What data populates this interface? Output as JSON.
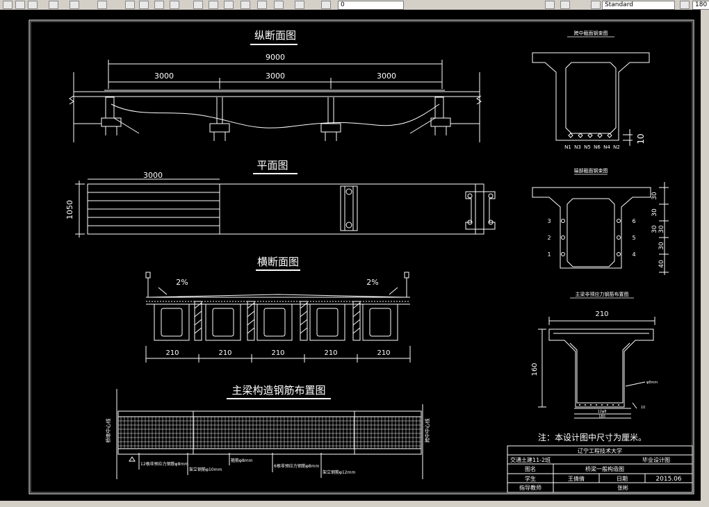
{
  "toolbar": {
    "text_style_value": "Standard",
    "number_field_value": "180",
    "small_field_value": "0"
  },
  "drawing": {
    "longitudinal": {
      "title": "纵断面图",
      "total_span": "9000",
      "spans": [
        "3000",
        "3000",
        "3000"
      ]
    },
    "plan": {
      "title": "平面图",
      "length_label": "3000",
      "width_label": "1050"
    },
    "cross_section": {
      "title": "横断面图",
      "slope_left": "2%",
      "slope_right": "2%",
      "beam_widths": [
        "210",
        "210",
        "210",
        "210",
        "210"
      ]
    },
    "main_beam_rebar": {
      "title": "主梁构造钢筋布置图",
      "left_axis_label": "桥墩中心线",
      "right_axis_label": "跨中中心线",
      "callouts": [
        "12根非预应力钢筋φ8mm",
        "架立钢筋φ10mm",
        "箍筋φ8mm",
        "6根非预应力钢筋φ8mm",
        "架立钢筋φ12mm"
      ]
    },
    "midspan_section": {
      "title": "跨中截面钢束图",
      "tendon_labels": [
        "N1",
        "N3",
        "N5",
        "N6",
        "N4",
        "N2"
      ],
      "dim": "10"
    },
    "end_section": {
      "title": "端部截面钢束图",
      "left_numbers": [
        "3",
        "2",
        "1"
      ],
      "right_numbers": [
        "6",
        "5",
        "4"
      ],
      "right_dims": [
        "30",
        "30",
        "30",
        "30",
        "30",
        "40"
      ]
    },
    "nonprestressed_section": {
      "title": "主梁非预应力钢筋布置图",
      "width_dim": "210",
      "height_dim": "160",
      "bar_label": "φ8mm",
      "bottom_label_1": "12φ8",
      "bottom_label_2": "180",
      "side_dim": "10"
    },
    "note": "注：本设计图中尺寸为厘米。",
    "title_block": {
      "school": "辽宁工程技术大学",
      "class_label": "交通土建11-2班",
      "design_type": "毕业设计图",
      "drawing_name_label": "图名",
      "drawing_name": "桥梁一般构造图",
      "student_label": "学生",
      "student_name": "王倩倩",
      "date_label": "日期",
      "date_value": "2015.06",
      "advisor_label": "指导教师",
      "advisor_name": "张彬"
    }
  }
}
